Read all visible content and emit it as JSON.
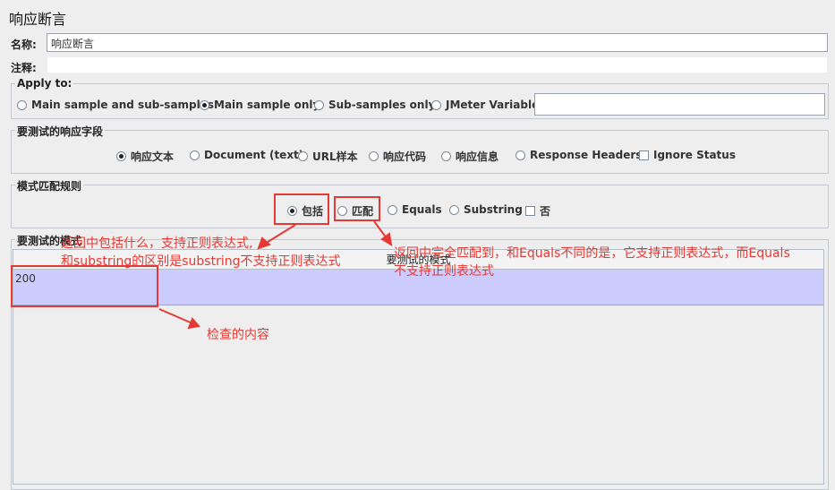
{
  "page_title": "响应断言",
  "name_field": {
    "label": "名称:",
    "value": "响应断言"
  },
  "comment_field": {
    "label": "注释:",
    "value": ""
  },
  "apply_to": {
    "title": "Apply to:",
    "options": [
      "Main sample and sub-samples",
      "Main sample only",
      "Sub-samples only",
      "JMeter Variable"
    ],
    "selected": "Main sample only",
    "variable_value": ""
  },
  "field_to_test": {
    "title": "要测试的响应字段",
    "options": [
      "响应文本",
      "Document (text)",
      "URL样本",
      "响应代码",
      "响应信息",
      "Response Headers"
    ],
    "selected": "响应文本",
    "ignore_status_label": "Ignore Status"
  },
  "pattern_rules": {
    "title": "模式匹配规则",
    "options": [
      "包括",
      "匹配",
      "Equals",
      "Substring"
    ],
    "selected": "包括",
    "not_label": "否"
  },
  "patterns": {
    "title": "要测试的模式",
    "column_header": "要测试的模式",
    "rows": [
      "200"
    ]
  },
  "annotations": {
    "contains_line1": "返回中包括什么，支持正则表达式,",
    "contains_line2": "和substring的区别是substring不支持正则表达式",
    "matches_line1": "返回中完全匹配到，和Equals不同的是，它支持正则表达式，而Equals",
    "matches_line2": "不支持正则表达式",
    "content_note": "检查的内容"
  },
  "colors": {
    "annotation": "#e53935",
    "row_selected": "#ccccff"
  }
}
